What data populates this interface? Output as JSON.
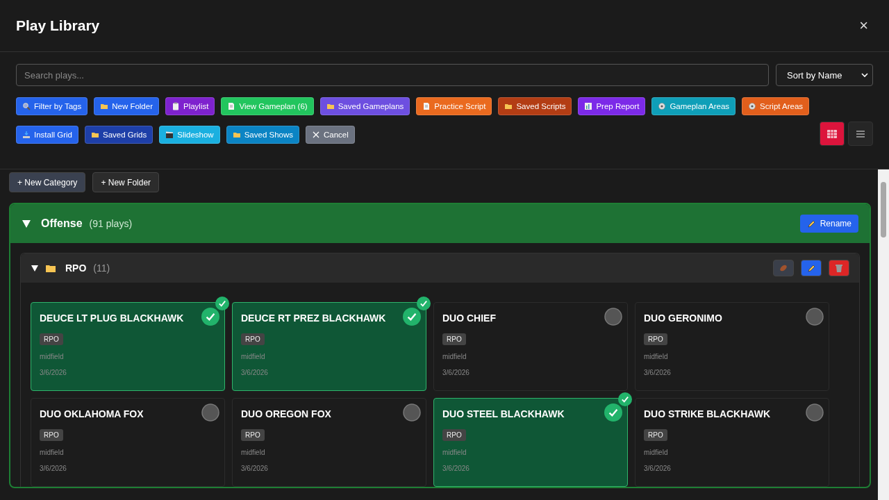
{
  "title": "Play Library",
  "close": "×",
  "search": {
    "placeholder": "Search plays..."
  },
  "sort": {
    "value": "Sort by Name"
  },
  "toolbar_rows": [
    [
      {
        "kind": "filter",
        "label": "Filter by Tags",
        "color": "#2563eb"
      },
      {
        "kind": "folder",
        "label": "New Folder",
        "color": "#2563eb"
      },
      {
        "kind": "playlist",
        "label": "Playlist",
        "color": "#7e22ce"
      },
      {
        "kind": "document",
        "label": "View Gameplan (6)",
        "color": "#22c55e"
      },
      {
        "kind": "folder",
        "label": "Saved Gameplans",
        "color": "#6d4fe0"
      },
      {
        "kind": "document",
        "label": "Practice Script",
        "color": "#ea6a1f"
      },
      {
        "kind": "folder",
        "label": "Saved Scripts",
        "color": "#b33d14"
      },
      {
        "kind": "report",
        "label": "Prep Report",
        "color": "#7c2ae8"
      },
      {
        "kind": "settings",
        "label": "Gameplan Areas",
        "color": "#0f9fb8"
      },
      {
        "kind": "settings",
        "label": "Script Areas",
        "color": "#e25f1c"
      }
    ],
    [
      {
        "kind": "install",
        "label": "Install Grid",
        "color": "#2563eb"
      },
      {
        "kind": "folder",
        "label": "Saved Grids",
        "color": "#1e3fa8"
      },
      {
        "kind": "slideshow",
        "label": "Slideshow",
        "color": "#1ab0e0"
      },
      {
        "kind": "folder",
        "label": "Saved Shows",
        "color": "#0b84c4"
      },
      {
        "kind": "cancel",
        "label": "Cancel",
        "color": "#6b7280"
      }
    ]
  ],
  "view_toggle": [
    {
      "kind": "grid",
      "selected": true
    },
    {
      "kind": "list",
      "selected": false
    }
  ],
  "actions": [
    "+ New Category",
    "+ New Folder"
  ],
  "category": {
    "name": "Offense",
    "count": "(91 plays)",
    "expanded": true,
    "rename": "Rename",
    "folder": {
      "name": "RPO",
      "count": "(11)",
      "expanded": true,
      "plays": [
        {
          "name": "DEUCE LT PLUG BLACKHAWK",
          "tag": "RPO",
          "area": "midfield",
          "date": "3/6/2026",
          "selected": true
        },
        {
          "name": "DEUCE RT PREZ BLACKHAWK",
          "tag": "RPO",
          "area": "midfield",
          "date": "3/6/2026",
          "selected": true
        },
        {
          "name": "DUO CHIEF",
          "tag": "RPO",
          "area": "midfield",
          "date": "3/6/2026",
          "selected": false
        },
        {
          "name": "DUO GERONIMO",
          "tag": "RPO",
          "area": "midfield",
          "date": "3/6/2026",
          "selected": false
        },
        {
          "name": "DUO OKLAHOMA FOX",
          "tag": "RPO",
          "area": "midfield",
          "date": "3/6/2026",
          "selected": false
        },
        {
          "name": "DUO OREGON FOX",
          "tag": "RPO",
          "area": "midfield",
          "date": "3/6/2026",
          "selected": false
        },
        {
          "name": "DUO STEEL BLACKHAWK",
          "tag": "RPO",
          "area": "midfield",
          "date": "3/6/2026",
          "selected": true
        },
        {
          "name": "DUO STRIKE BLACKHAWK",
          "tag": "RPO",
          "area": "midfield",
          "date": "3/6/2026",
          "selected": false
        }
      ]
    }
  }
}
